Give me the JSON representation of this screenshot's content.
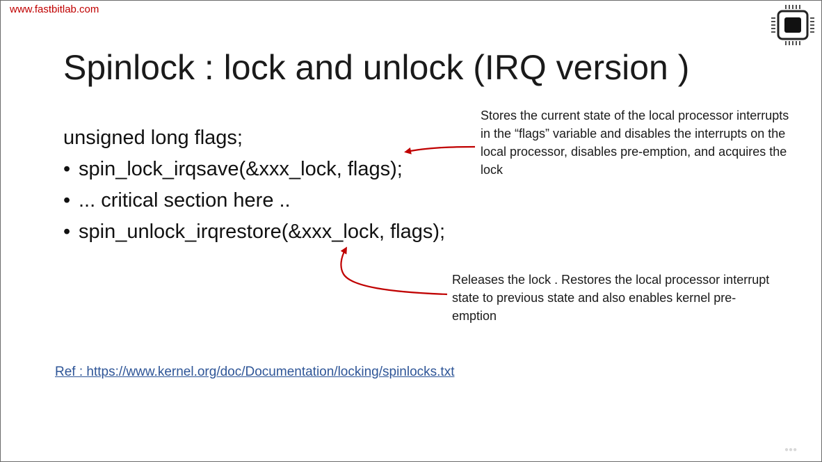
{
  "header": {
    "site_url": "www.fastbitlab.com"
  },
  "slide": {
    "title": "Spinlock : lock and unlock (IRQ version )",
    "code": {
      "declaration": "unsigned long flags;",
      "bullet_char": "•",
      "bullets": [
        "spin_lock_irqsave(&xxx_lock, flags);",
        "... critical section here ..",
        "spin_unlock_irqrestore(&xxx_lock, flags);"
      ]
    },
    "annotations": {
      "top": "Stores the current state of the local processor interrupts in the “flags” variable and disables the interrupts on the local processor, disables pre-emption, and acquires the lock",
      "bottom": "Releases the lock . Restores the local processor interrupt state to previous state and also enables kernel pre-emption"
    },
    "reference": "Ref : https://www.kernel.org/doc/Documentation/locking/spinlocks.txt"
  },
  "icons": {
    "logo": "chip-icon",
    "arrow_color": "#c00000",
    "watermark": "udemy-logo"
  }
}
